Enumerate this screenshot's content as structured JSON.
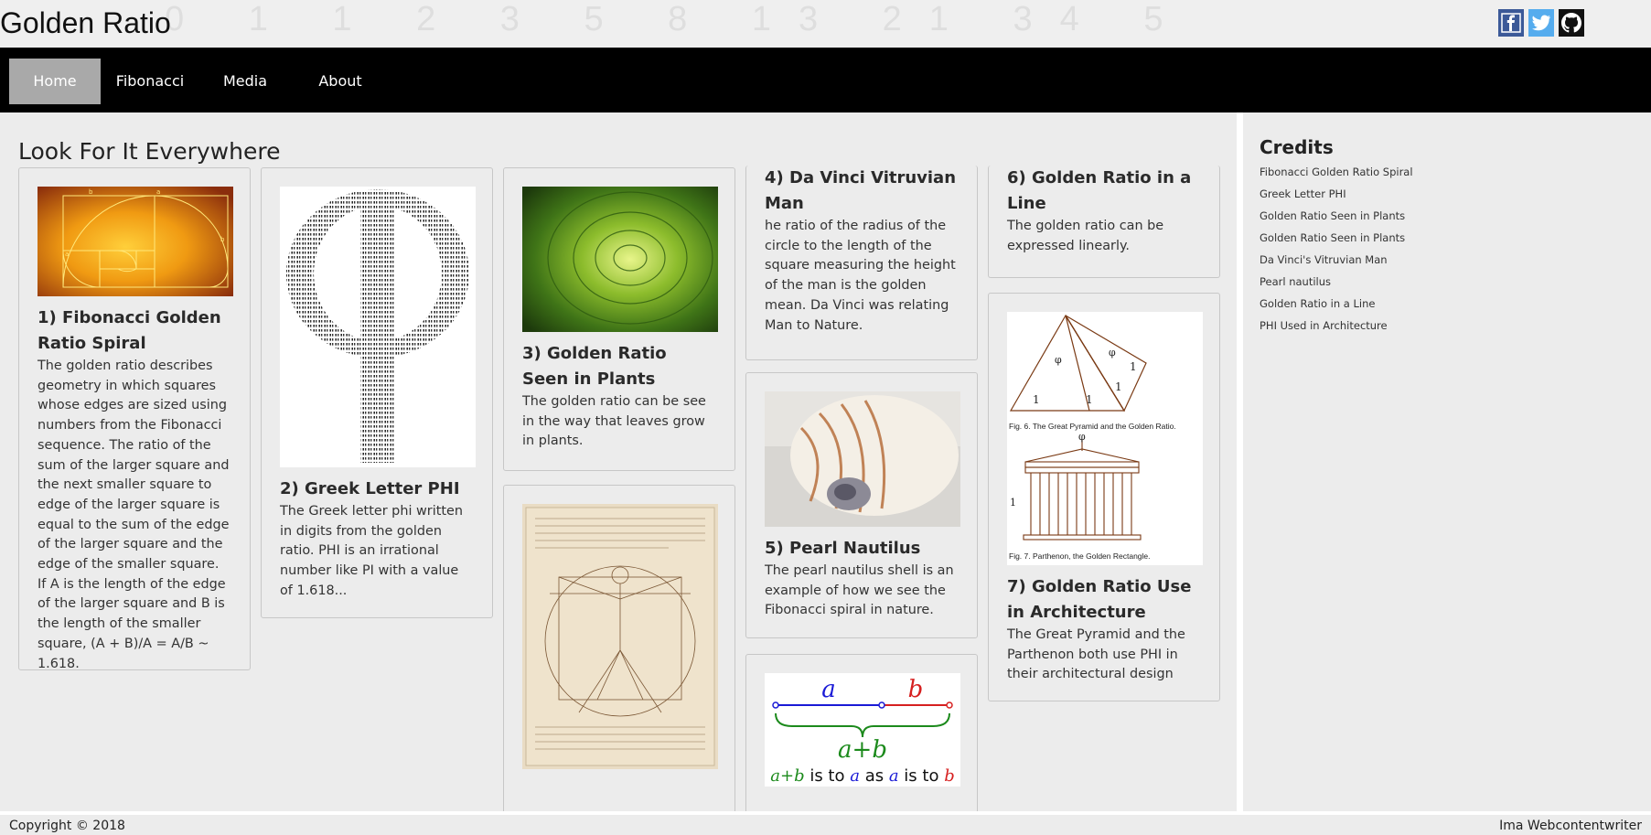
{
  "header": {
    "title": "Golden Ratio",
    "background_numbers": "0 1 1 2 3 5 8 13 21 34 5",
    "social": [
      {
        "name": "facebook-icon",
        "color": "#3b5998"
      },
      {
        "name": "twitter-icon",
        "color": "#55acee"
      },
      {
        "name": "github-icon",
        "color": "#111111"
      }
    ]
  },
  "nav": {
    "items": [
      {
        "label": "Home",
        "active": true
      },
      {
        "label": "Fibonacci"
      },
      {
        "label": "Media"
      },
      {
        "label": "About"
      }
    ]
  },
  "main": {
    "title": "Look For It Everywhere",
    "cards": [
      {
        "title": "1) Fibonacci Golden Ratio Spiral",
        "text": "The golden ratio describes geometry in which squares whose edges are sized using numbers from the Fibonacci sequence. The ratio of the sum of the larger square and the next smaller square to edge of the larger square is equal to the sum of the edge of the larger square and the edge of the smaller square. If A is the length of the edge of the larger square and B is the length of the smaller square, (A + B)/A = A/B ~ 1.618."
      },
      {
        "title": "2) Greek Letter PHI",
        "text": "The Greek letter phi written in digits from the golden ratio. PHI is an irrational number like PI with a value of 1.618..."
      },
      {
        "title": "3) Golden Ratio Seen in Plants",
        "text": "The golden ratio can be see in the way that leaves grow in plants."
      },
      {
        "title": "4) Da Vinci Vitruvian Man",
        "text": "he ratio of the radius of the circle to the length of the square measuring the height of the man is the golden mean. Da Vinci was relating Man to Nature."
      },
      {
        "title": "5) Pearl Nautilus",
        "text": "The pearl nautilus shell is an example of how we see the Fibonacci spiral in nature."
      },
      {
        "title": "6) Golden Ratio in a Line",
        "text": "The golden ratio can be expressed linearly."
      },
      {
        "title": "7) Golden Ratio Use in Architecture",
        "text": "The Great Pyramid and the Parthenon both use PHI in their architectural design"
      }
    ],
    "figures": {
      "spiral_labels": [
        "b",
        "a",
        "a",
        "b"
      ],
      "line_a": "a",
      "line_b": "b",
      "line_ab": "a+b",
      "line_caption_1": "a+b",
      "line_caption_2": " is to ",
      "line_caption_3": "a",
      "line_caption_4": " as ",
      "line_caption_5": "a",
      "line_caption_6": " is to ",
      "line_caption_7": "b",
      "pyramid_caption": "Fig. 6. The Great Pyramid and the Golden Ratio.",
      "parthenon_caption": "Fig. 7. Parthenon, the Golden Rectangle.",
      "pyramid_labels": [
        "φ",
        "φ",
        "1",
        "1",
        "1",
        "1"
      ],
      "parthenon_labels": [
        "φ",
        "1"
      ]
    }
  },
  "sidebar": {
    "title": "Credits",
    "credits": [
      "Fibonacci Golden Ratio Spiral",
      "Greek Letter PHI",
      "Golden Ratio Seen in Plants",
      "Golden Ratio Seen in Plants",
      "Da Vinci's Vitruvian Man",
      "Pearl nautilus",
      "Golden Ratio in a Line",
      "PHI Used in Architecture"
    ]
  },
  "footer": {
    "copyright": "Copyright © 2018",
    "author": "Ima Webcontentwriter"
  },
  "colors": {
    "nav_bg": "#000000",
    "nav_active": "#a9a9a9",
    "page_bg": "#ececec"
  }
}
